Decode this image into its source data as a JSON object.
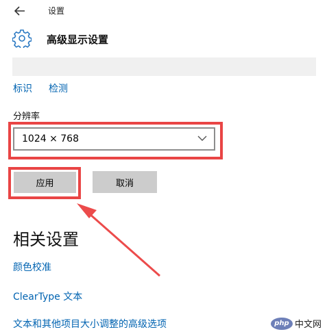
{
  "header": {
    "app_title": "设置"
  },
  "page": {
    "title": "高级显示设置"
  },
  "links": {
    "identify": "标识",
    "detect": "检测"
  },
  "resolution": {
    "label": "分辨率",
    "value": "1024 × 768"
  },
  "buttons": {
    "apply": "应用",
    "cancel": "取消"
  },
  "related": {
    "title": "相关设置",
    "items": [
      "颜色校准",
      "ClearType 文本",
      "文本和其他项目大小调整的高级选项"
    ]
  },
  "watermark": {
    "logo": "php",
    "text": "中文网"
  },
  "colors": {
    "accent_link": "#0063b1",
    "highlight": "#e94545",
    "button": "#cccccc"
  },
  "icons": {
    "back": "arrow-left-icon",
    "settings": "gear-icon",
    "dropdown": "chevron-down-icon"
  }
}
